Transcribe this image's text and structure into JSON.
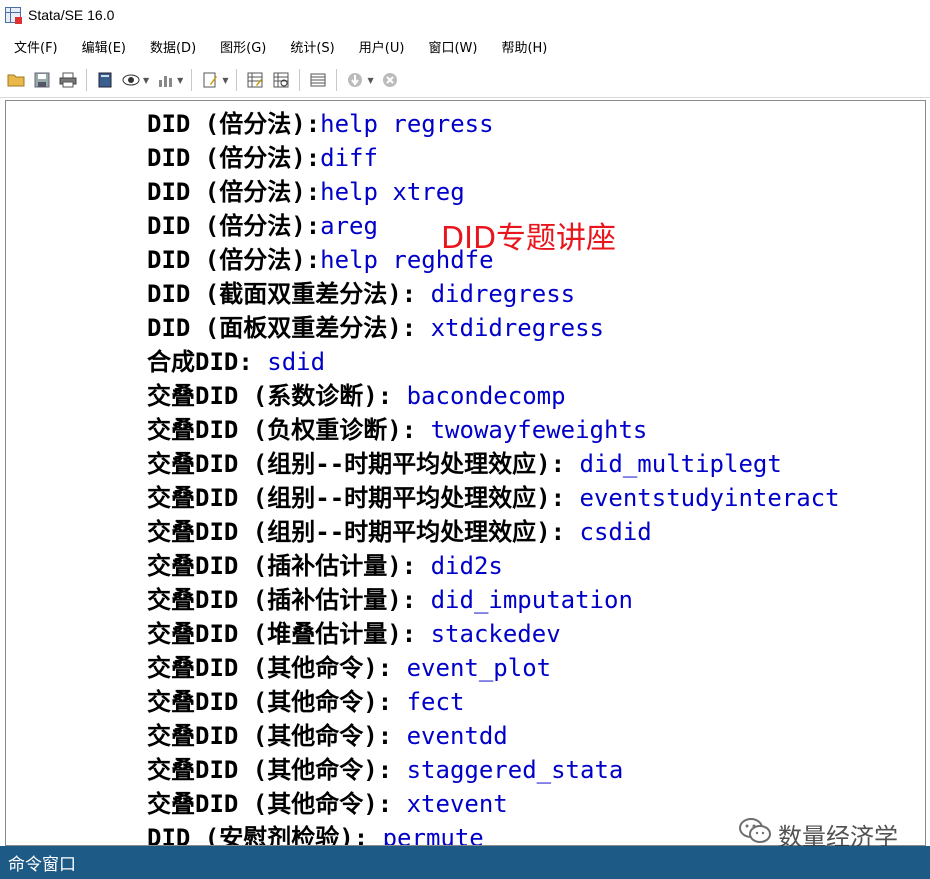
{
  "window": {
    "title": "Stata/SE 16.0"
  },
  "menu": [
    "文件(F)",
    "编辑(E)",
    "数据(D)",
    "图形(G)",
    "统计(S)",
    "用户(U)",
    "窗口(W)",
    "帮助(H)"
  ],
  "toolbar": {
    "buttons": [
      "open-icon",
      "save-icon",
      "print-icon",
      "log-icon",
      "viewer-icon",
      "graph-icon",
      "do-file-editor-icon",
      "data-editor-icon",
      "data-browser-icon",
      "variables-manager-icon",
      "break-icon",
      "stop-icon"
    ]
  },
  "results": {
    "overlay_title": "DID专题讲座",
    "lines": [
      {
        "label": "DID (倍分法):",
        "command": "help regress"
      },
      {
        "label": "DID (倍分法):",
        "command": "diff"
      },
      {
        "label": "DID (倍分法):",
        "command": "help xtreg"
      },
      {
        "label": "DID (倍分法):",
        "command": "areg"
      },
      {
        "label": "DID (倍分法):",
        "command": "help reghdfe"
      },
      {
        "label": "DID (截面双重差分法):",
        "command": " didregress"
      },
      {
        "label": "DID (面板双重差分法):",
        "command": "  xtdidregress"
      },
      {
        "label": "合成DID:",
        "command": "  sdid"
      },
      {
        "label": "交叠DID (系数诊断):",
        "command": "  bacondecomp"
      },
      {
        "label": "交叠DID (负权重诊断):",
        "command": "  twowayfeweights"
      },
      {
        "label": "交叠DID (组别--时期平均处理效应):",
        "command": " did_multiplegt"
      },
      {
        "label": "交叠DID (组别--时期平均处理效应):",
        "command": " eventstudyinteract"
      },
      {
        "label": "交叠DID (组别--时期平均处理效应):",
        "command": " csdid"
      },
      {
        "label": "交叠DID (插补估计量):",
        "command": "  did2s"
      },
      {
        "label": "交叠DID (插补估计量):",
        "command": "  did_imputation"
      },
      {
        "label": "交叠DID (堆叠估计量):",
        "command": "  stackedev"
      },
      {
        "label": "交叠DID (其他命令):",
        "command": "  event_plot"
      },
      {
        "label": "交叠DID (其他命令):",
        "command": "  fect"
      },
      {
        "label": "交叠DID (其他命令):",
        "command": "  eventdd"
      },
      {
        "label": "交叠DID (其他命令):",
        "command": "  staggered_stata"
      },
      {
        "label": "交叠DID (其他命令):",
        "command": "  xtevent"
      },
      {
        "label": "DID (安慰剂检验):",
        "command": "  permute"
      }
    ]
  },
  "watermark": {
    "text": "数量经济学",
    "icon": "wechat-icon"
  },
  "status": {
    "command_window": "命令窗口"
  },
  "colors": {
    "command": "#0000c8",
    "overlay": "#e8161c",
    "statusbar": "#1e5a86"
  }
}
